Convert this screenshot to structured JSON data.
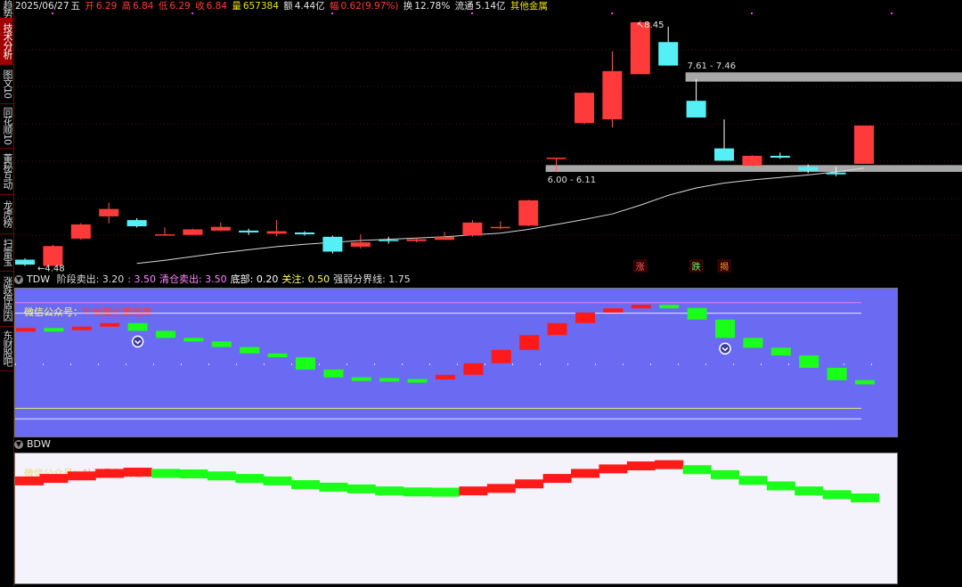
{
  "sidebar": {
    "tabs": [
      {
        "label": "趋势",
        "active": false
      },
      {
        "label": "技术分析",
        "active": true
      },
      {
        "label": "图文10",
        "active": false
      },
      {
        "label": "同花顺10",
        "active": false
      },
      {
        "label": "董秘互动",
        "active": false
      },
      {
        "label": "龙虎榜",
        "active": false
      },
      {
        "label": "扫雷宝",
        "active": false
      },
      {
        "label": "涨跌停原因",
        "active": false
      },
      {
        "label": "东财股吧",
        "active": false
      }
    ]
  },
  "infobar": {
    "date": "2025/06/27",
    "weekday": "五",
    "open_label": "开",
    "open": "6.29",
    "high_label": "高",
    "high": "6.84",
    "low_label": "低",
    "low": "6.29",
    "close_label": "收",
    "close": "6.84",
    "volume_label": "量",
    "volume": "657384",
    "amount_label": "额",
    "amount": "4.44亿",
    "change_label": "幅",
    "change": "0.62(9.97%)",
    "turnover_label": "换",
    "turnover": "12.78%",
    "float_label": "流通",
    "float": "5.14亿",
    "sector": "其他金属"
  },
  "colors": {
    "up": "#ff3a3a",
    "down": "#55f0f5",
    "ma": "#d8d8d8",
    "zone": "#a8a8a8",
    "ind_up": "#ff1a1a",
    "ind_down": "#19ff19",
    "tdw_bg": "#6a6af2",
    "bdw_bg": "#f4f2fb"
  },
  "main_chart": {
    "candles": [
      {
        "o": 4.58,
        "c": 4.5,
        "h": 4.6,
        "l": 4.48
      },
      {
        "o": 4.48,
        "c": 4.8,
        "h": 4.82,
        "l": 4.48
      },
      {
        "o": 4.92,
        "c": 5.15,
        "h": 5.17,
        "l": 4.9
      },
      {
        "o": 5.28,
        "c": 5.4,
        "h": 5.5,
        "l": 5.17
      },
      {
        "o": 5.22,
        "c": 5.12,
        "h": 5.25,
        "l": 5.1
      },
      {
        "o": 4.98,
        "c": 4.99,
        "h": 5.1,
        "l": 4.98
      },
      {
        "o": 4.98,
        "c": 5.07,
        "h": 5.08,
        "l": 4.98
      },
      {
        "o": 5.05,
        "c": 5.11,
        "h": 5.18,
        "l": 5.04
      },
      {
        "o": 5.05,
        "c": 5.02,
        "h": 5.08,
        "l": 4.98
      },
      {
        "o": 5.0,
        "c": 5.04,
        "h": 5.22,
        "l": 4.96
      },
      {
        "o": 5.02,
        "c": 4.99,
        "h": 5.04,
        "l": 4.97
      },
      {
        "o": 4.95,
        "c": 4.71,
        "h": 4.97,
        "l": 4.68
      },
      {
        "o": 4.79,
        "c": 4.86,
        "h": 4.99,
        "l": 4.76
      },
      {
        "o": 4.9,
        "c": 4.89,
        "h": 4.95,
        "l": 4.84
      },
      {
        "o": 4.88,
        "c": 4.91,
        "h": 4.94,
        "l": 4.86
      },
      {
        "o": 4.9,
        "c": 4.95,
        "h": 5.03,
        "l": 4.9
      },
      {
        "o": 4.97,
        "c": 5.18,
        "h": 5.22,
        "l": 4.95
      },
      {
        "o": 5.09,
        "c": 5.11,
        "h": 5.2,
        "l": 5.07
      },
      {
        "o": 5.13,
        "c": 5.54,
        "h": 5.55,
        "l": 5.12
      },
      {
        "o": 6.22,
        "c": 6.23,
        "h": 6.23,
        "l": 6.0
      },
      {
        "o": 6.79,
        "c": 7.28,
        "h": 7.29,
        "l": 6.77
      },
      {
        "o": 6.85,
        "c": 7.63,
        "h": 7.95,
        "l": 6.72
      },
      {
        "o": 7.58,
        "c": 8.42,
        "h": 8.45,
        "l": 7.58
      },
      {
        "o": 8.1,
        "c": 7.72,
        "h": 8.35,
        "l": 7.72
      },
      {
        "o": 7.15,
        "c": 6.88,
        "h": 7.5,
        "l": 6.88
      },
      {
        "o": 6.38,
        "c": 6.18,
        "h": 6.85,
        "l": 6.18
      },
      {
        "o": 6.1,
        "c": 6.26,
        "h": 6.27,
        "l": 6.08
      },
      {
        "o": 6.26,
        "c": 6.23,
        "h": 6.31,
        "l": 6.21
      },
      {
        "o": 6.08,
        "c": 6.02,
        "h": 6.12,
        "l": 5.98
      },
      {
        "o": 5.99,
        "c": 5.96,
        "h": 6.08,
        "l": 5.93
      },
      {
        "o": 6.13,
        "c": 6.75,
        "h": 6.75,
        "l": 6.13
      }
    ],
    "ma": [
      null,
      null,
      null,
      null,
      4.52,
      4.57,
      4.63,
      4.69,
      4.74,
      4.79,
      4.83,
      4.86,
      4.89,
      4.91,
      4.93,
      4.95,
      4.98,
      5.01,
      5.07,
      5.15,
      5.23,
      5.32,
      5.46,
      5.62,
      5.74,
      5.82,
      5.87,
      5.91,
      5.95,
      6.0,
      6.06
    ],
    "y_range": [
      4.4,
      8.55
    ],
    "high_label": "8.45",
    "low_label": "4.48",
    "zones": [
      {
        "from": 7.46,
        "to": 7.61,
        "start": 24,
        "label": "7.61 - 7.46"
      },
      {
        "from": 6.0,
        "to": 6.11,
        "start": 19,
        "label": "6.00 - 6.11"
      }
    ],
    "markers": [
      {
        "index": 22,
        "text": "涨",
        "color": "#ff6060"
      },
      {
        "index": 24,
        "text": "跌",
        "color": "#66ff66"
      },
      {
        "index": 25,
        "text": "揭",
        "color": "#ff9933"
      }
    ]
  },
  "tdw": {
    "title": "TDW",
    "params": [
      {
        "label": "阶段卖出",
        "value": "3.20"
      },
      {
        "label": "",
        "value": "3.50"
      },
      {
        "label": "清仓卖出",
        "value": "3.50"
      },
      {
        "label": "底部",
        "value": "0.20"
      },
      {
        "label": "关注",
        "value": "0.50"
      },
      {
        "label": "强弱分界线",
        "value": "1.75"
      }
    ],
    "watermark_prefix": "微信公众号：",
    "watermark_name": "叶尚量化策略库",
    "values": [
      2.78,
      2.74,
      2.82,
      2.92,
      2.7,
      2.5,
      2.4,
      2.24,
      2.06,
      1.95,
      1.6,
      1.38,
      1.36,
      1.33,
      1.32,
      1.45,
      1.78,
      2.16,
      2.58,
      2.92,
      3.22,
      3.34,
      3.44,
      3.35,
      3.02,
      2.5,
      2.22,
      2.0,
      1.65,
      1.3,
      1.18
    ],
    "levels": [
      {
        "value": 3.5,
        "color": "#ff88ff"
      },
      {
        "value": 3.2,
        "color": "#ffffff"
      },
      {
        "value": 0.5,
        "color": "#ffff66"
      },
      {
        "value": 0.2,
        "color": "#ffffff"
      }
    ],
    "y_range": [
      -0.3,
      3.9
    ],
    "signals": [
      4,
      25
    ]
  },
  "bdw": {
    "title": "BDW",
    "watermark_prefix": "微信公众号：",
    "watermark_name": "叶尚量化策略库",
    "values": [
      1.1,
      1.2,
      1.3,
      1.4,
      1.45,
      1.4,
      1.38,
      1.3,
      1.2,
      1.1,
      0.95,
      0.85,
      0.78,
      0.7,
      0.66,
      0.65,
      0.7,
      0.8,
      0.98,
      1.2,
      1.4,
      1.58,
      1.7,
      1.75,
      1.55,
      1.35,
      1.12,
      0.9,
      0.7,
      0.55,
      0.42
    ],
    "y_range": [
      -3.0,
      2.2
    ]
  }
}
